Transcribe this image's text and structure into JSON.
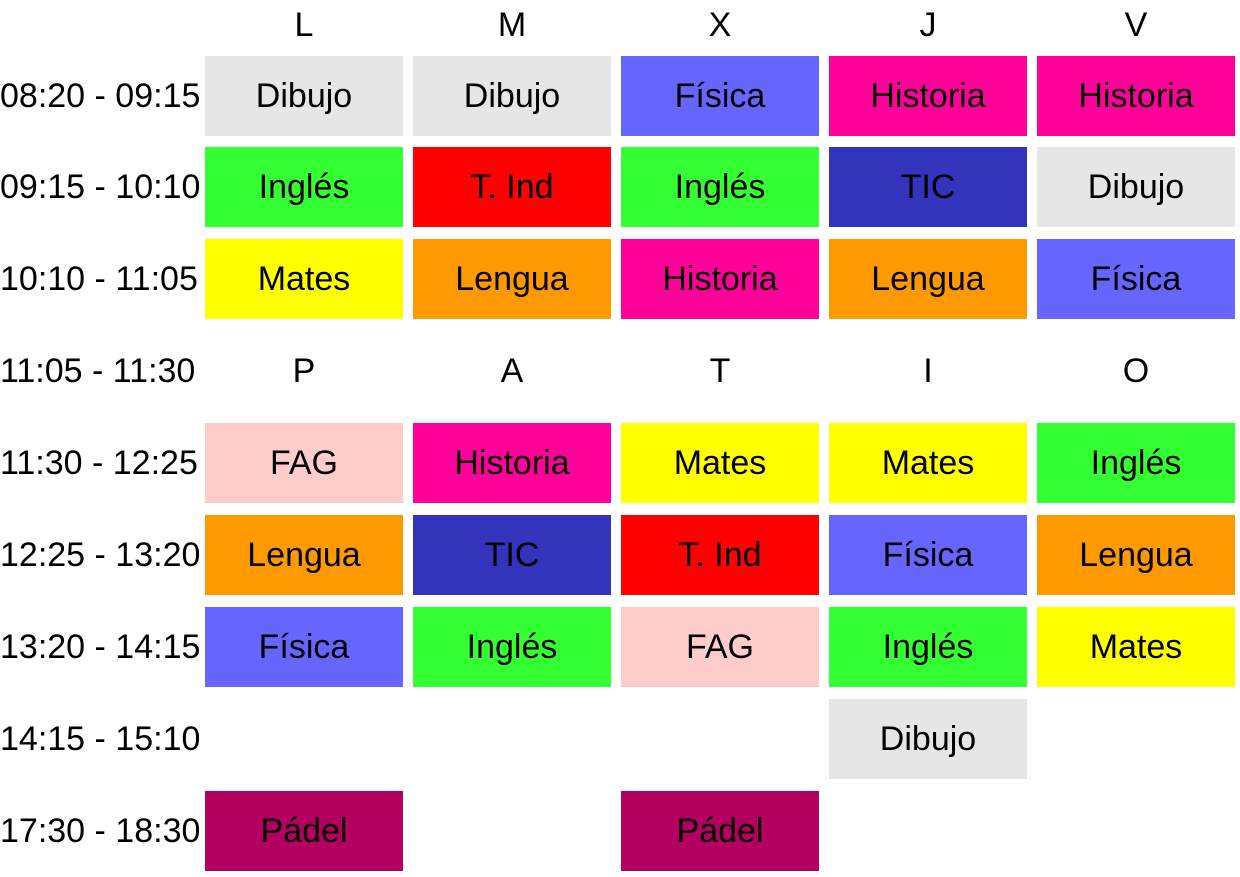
{
  "days": [
    "L",
    "M",
    "X",
    "J",
    "V"
  ],
  "break_letters": [
    "P",
    "A",
    "T",
    "I",
    "O"
  ],
  "colors": {
    "Dibujo": "#e6e6e6",
    "Física": "#6666ff",
    "Historia": "#ff0099",
    "Inglés": "#33ff33",
    "T. Ind": "#ff0000",
    "TIC": "#3333bb",
    "Mates": "#ffff00",
    "Lengua": "#ff9900",
    "FAG": "#ffcccc",
    "Pádel": "#b30060"
  },
  "rows": [
    {
      "time": "08:20 - 09:15",
      "cells": [
        "Dibujo",
        "Dibujo",
        "Física",
        "Historia",
        "Historia"
      ]
    },
    {
      "time": "09:15 - 10:10",
      "cells": [
        "Inglés",
        "T. Ind",
        "Inglés",
        "TIC",
        "Dibujo"
      ]
    },
    {
      "time": "10:10 - 11:05",
      "cells": [
        "Mates",
        "Lengua",
        "Historia",
        "Lengua",
        "Física"
      ]
    },
    {
      "time": "11:05 - 11:30",
      "break": true
    },
    {
      "time": "11:30 - 12:25",
      "cells": [
        "FAG",
        "Historia",
        "Mates",
        "Mates",
        "Inglés"
      ]
    },
    {
      "time": "12:25 - 13:20",
      "cells": [
        "Lengua",
        "TIC",
        "T. Ind",
        "Física",
        "Lengua"
      ]
    },
    {
      "time": "13:20 - 14:15",
      "cells": [
        "Física",
        "Inglés",
        "FAG",
        "Inglés",
        "Mates"
      ]
    },
    {
      "time": "14:15 - 15:10",
      "cells": [
        "",
        "",
        "",
        "Dibujo",
        ""
      ]
    },
    {
      "time": "17:30 - 18:30",
      "cells": [
        "Pádel",
        "",
        "Pádel",
        "",
        ""
      ]
    }
  ]
}
